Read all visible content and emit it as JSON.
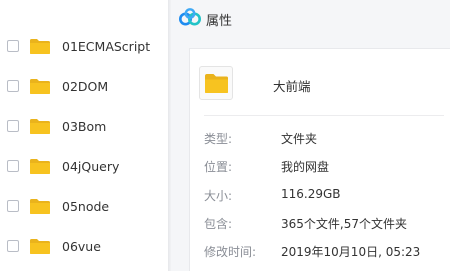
{
  "file_list": {
    "items": [
      {
        "name": "01ECMAScript"
      },
      {
        "name": "02DOM"
      },
      {
        "name": "03Bom"
      },
      {
        "name": "04jQuery"
      },
      {
        "name": "05node"
      },
      {
        "name": "06vue"
      }
    ]
  },
  "dialog": {
    "title": "属性",
    "app_icon": "baidu-netdisk-logo-icon",
    "folder_name": "大前端",
    "folder_icon": "folder-icon",
    "properties": [
      {
        "label": "类型:",
        "value": "文件夹"
      },
      {
        "label": "位置:",
        "value": "我的网盘"
      },
      {
        "label": "大小:",
        "value": "116.29GB"
      },
      {
        "label": "包含:",
        "value": "365个文件,57个文件夹"
      },
      {
        "label": "修改时间:",
        "value": "2019年10月10日, 05:23"
      }
    ]
  },
  "colors": {
    "folder_yellow": "#f7c320",
    "folder_yellow_dark": "#eab31c",
    "logo_blue": "#1e8cf0",
    "logo_cyan": "#21c3c7",
    "label_gray": "#8a8e96"
  }
}
